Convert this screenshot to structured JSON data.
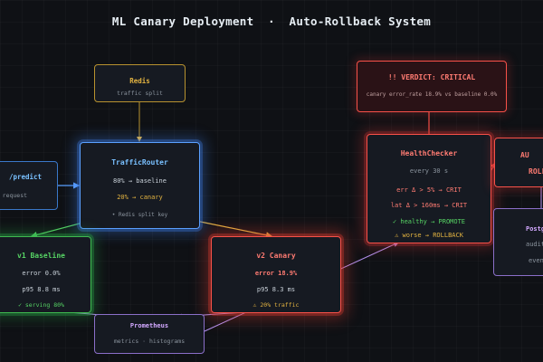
{
  "title": "ML Canary Deployment  ·  Auto-Rollback System",
  "nodes": {
    "redis": {
      "title": "Redis",
      "sub": "traffic split"
    },
    "predict": {
      "title": "/predict",
      "sub": "ing request"
    },
    "router": {
      "title": "TrafficRouter",
      "line1": "80%  →  baseline",
      "line2": "20%  →  canary",
      "line3": "• Redis split key"
    },
    "v1": {
      "title": "v1  Baseline",
      "line1": "error  0.0%",
      "line2": "p95   8.8 ms",
      "line3": "✓  serving 80%"
    },
    "v2": {
      "title": "v2  Canary",
      "line1": "error  18.9%",
      "line2": "p95   8.3 ms",
      "line3": "⚠  20% traffic"
    },
    "prometheus": {
      "title": "Prometheus",
      "sub": "metrics  ·  histograms"
    },
    "verdict": {
      "title": "!!  VERDICT: CRITICAL",
      "sub": "canary error_rate 18.9% vs baseline 0.0%"
    },
    "health": {
      "title": "HealthChecker",
      "line1": "every 30 s",
      "line2": "err Δ > 5%  → CRIT",
      "line3": "lat Δ > 160ms → CRIT",
      "line4": "✓ healthy → PROMOTE",
      "line5": "⚠ worse  → ROLLBACK"
    },
    "rollback": {
      "title": "AU",
      "line1": "ROLL"
    },
    "postgres": {
      "title": "Postg",
      "line1": "audit",
      "line2": "event"
    }
  },
  "colors": {
    "blue": "#5aa0ff",
    "green": "#3fb950",
    "red": "#f85149",
    "amber": "#e3b341",
    "purple": "#8b6fc9"
  }
}
